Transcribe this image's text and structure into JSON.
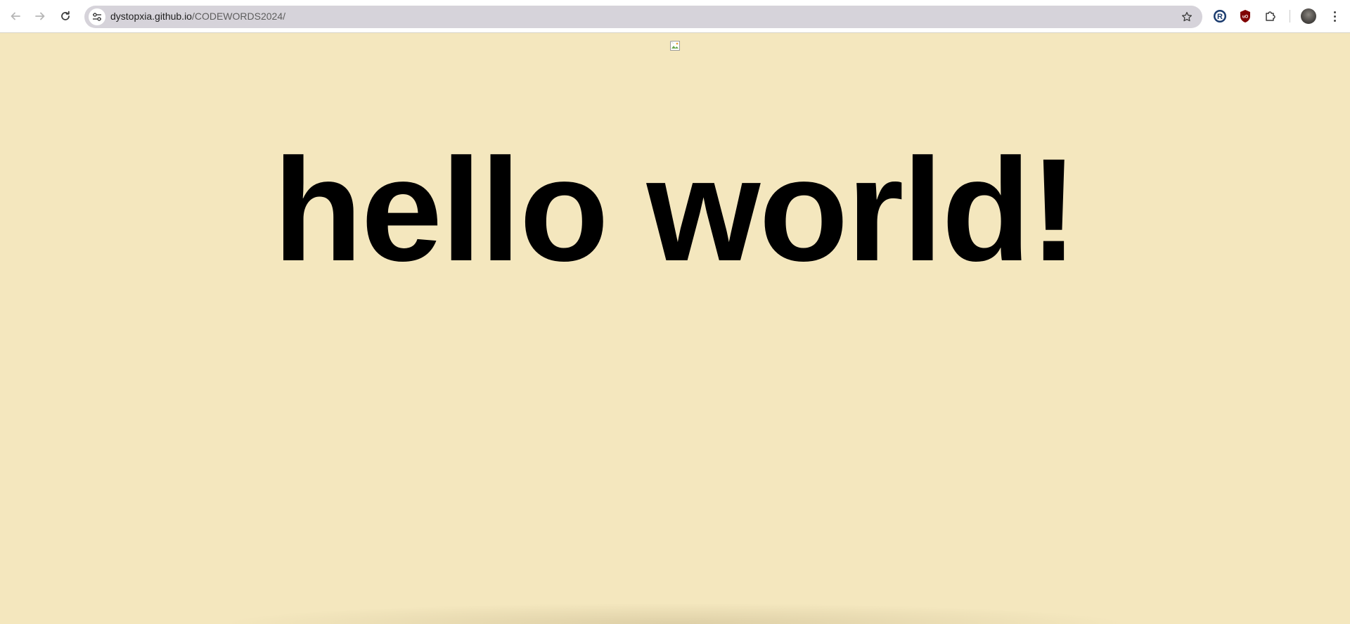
{
  "browser": {
    "url_host": "dystopxia.github.io",
    "url_path": "/CODEWORDS2024/",
    "icons": {
      "back": "arrow-left-icon",
      "forward": "arrow-right-icon",
      "reload": "reload-icon",
      "site_info": "tune-icon",
      "bookmark": "star-icon",
      "ext1": "r-logo-icon",
      "ext2": "shield-icon",
      "extensions": "puzzle-icon",
      "menu": "kebab-menu-icon"
    }
  },
  "page": {
    "headline": "hello world!",
    "background": "#f4e7be"
  }
}
